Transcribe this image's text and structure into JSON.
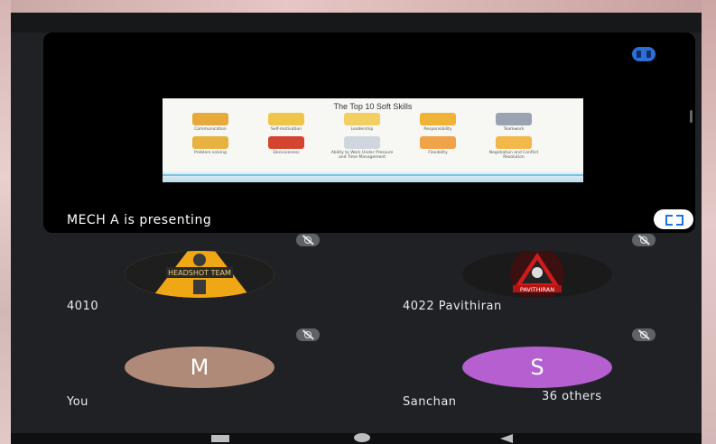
{
  "presentation": {
    "presenter_label": "MECH A is presenting",
    "slide_title": "The Top 10 Soft Skills",
    "skills": [
      "Communication",
      "Self-motivation",
      "Leadership",
      "Responsibility",
      "Teamwork",
      "Problem solving",
      "Decisiveness",
      "Ability to Work Under Pressure and Time Management",
      "Flexibility",
      "Negotiation and Conflict Resolution"
    ],
    "pin_icon": "pin-icon",
    "fullscreen_icon": "fullscreen-icon"
  },
  "participants": [
    {
      "name": "4010",
      "avatar": "image",
      "mic": "muted"
    },
    {
      "name": "4022 Pavithiran",
      "avatar": "image",
      "mic": "muted"
    },
    {
      "name": "You",
      "avatar_letter": "M",
      "avatar_color": "#b08a78",
      "mic": "muted"
    },
    {
      "name": "Sanchan",
      "avatar_letter": "S",
      "avatar_color": "#b55fd0",
      "mic": "muted"
    }
  ],
  "others_label": "36 others",
  "navbar": {
    "back": "back-icon",
    "home": "home-icon",
    "recent": "recents-icon"
  }
}
